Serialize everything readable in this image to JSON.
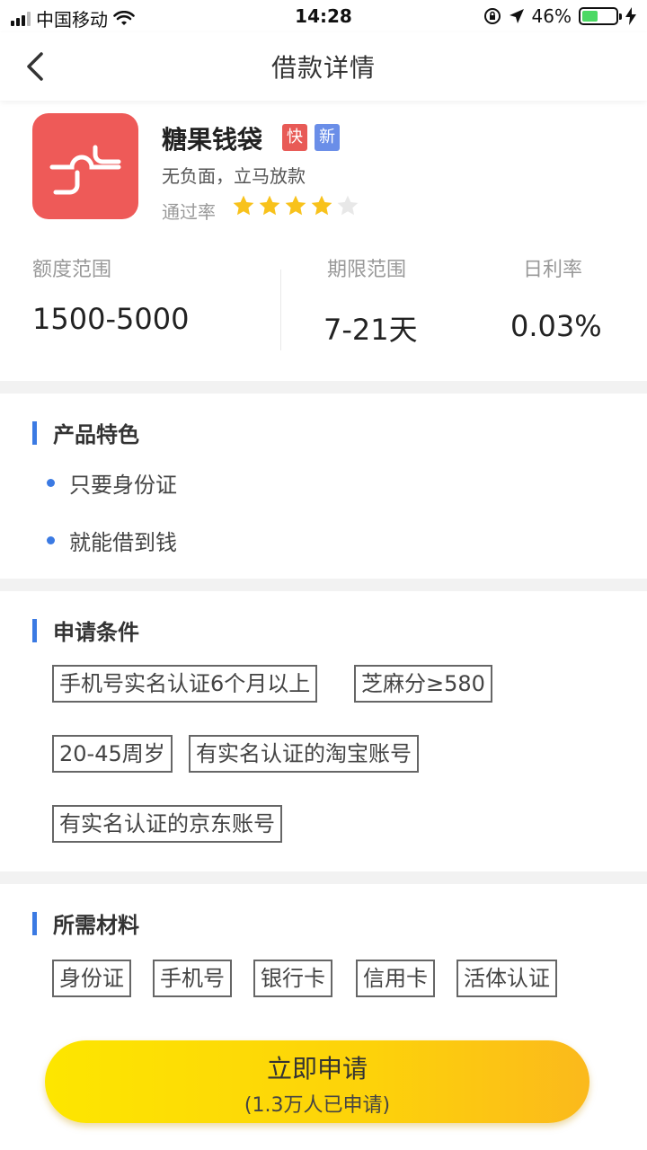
{
  "status_bar": {
    "carrier": "中国移动",
    "time": "14:28",
    "battery_pct": "46%",
    "battery_level": 0.46
  },
  "nav": {
    "title": "借款详情"
  },
  "product": {
    "name": "糖果钱袋",
    "tag_fast": "快",
    "tag_new": "新",
    "slogan": "无负面，立马放款",
    "pass_rate_label": "通过率",
    "pass_rate_stars": 4,
    "pass_rate_max": 5,
    "amount_label": "额度范围",
    "amount_value": "1500-5000",
    "term_label": "期限范围",
    "term_value": "7-21天",
    "rate_label": "日利率",
    "rate_value": "0.03%"
  },
  "features": {
    "title": "产品特色",
    "items": [
      "只要身份证",
      "就能借到钱"
    ]
  },
  "conditions": {
    "title": "申请条件",
    "items": [
      "手机号实名认证6个月以上",
      "芝麻分≥580",
      "20-45周岁",
      "有实名认证的淘宝账号",
      "有实名认证的京东账号"
    ]
  },
  "materials": {
    "title": "所需材料",
    "items": [
      "身份证",
      "手机号",
      "银行卡",
      "信用卡",
      "活体认证"
    ]
  },
  "apply": {
    "label": "立即申请",
    "sub": "(1.3万人已申请)"
  },
  "colors": {
    "accent_blue": "#3b7ae3",
    "logo_red": "#ee5a58",
    "tag_red": "#e85a56",
    "tag_blue": "#6a8ee8",
    "star_gold": "#f8c21c",
    "button_yellow": "#fde600",
    "button_orange": "#fbb91c"
  }
}
